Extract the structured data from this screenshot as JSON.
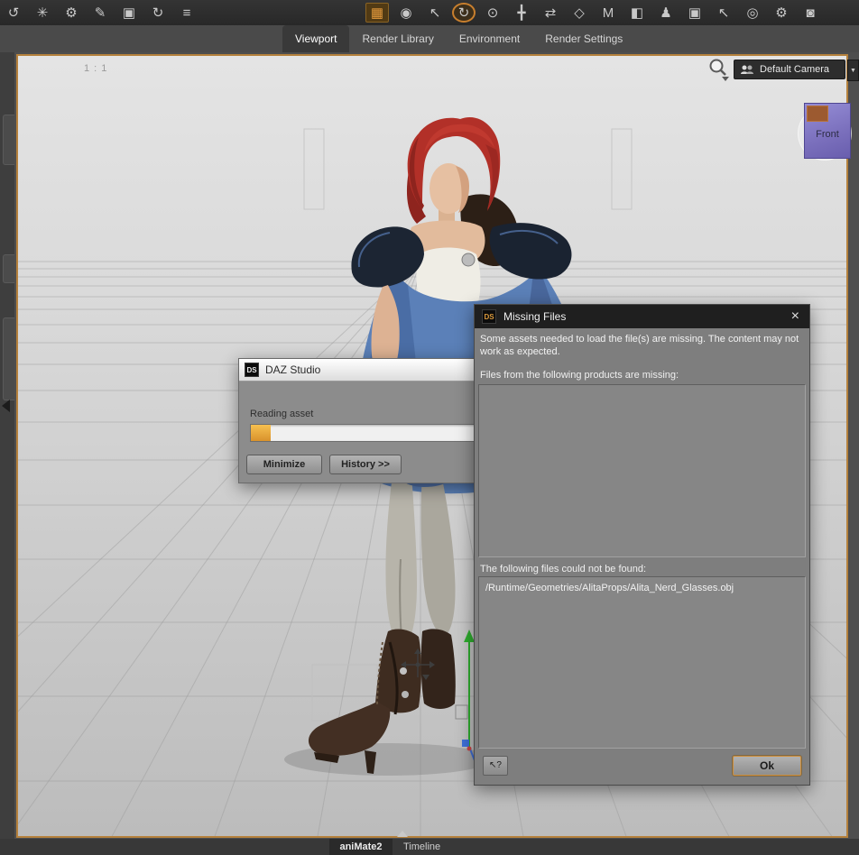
{
  "colors": {
    "accent_orange": "#c08238",
    "viewport_border": "#b5813c"
  },
  "toolbar": {
    "left_icons": [
      {
        "name": "orbit-left-icon",
        "glyph": "↺"
      },
      {
        "name": "snowflake-icon",
        "glyph": "✳"
      },
      {
        "name": "gear-sphere-icon",
        "glyph": "⚙"
      },
      {
        "name": "pen-tool-icon",
        "glyph": "✎"
      },
      {
        "name": "frame-camera-icon",
        "glyph": "▣"
      },
      {
        "name": "orbit-right-icon",
        "glyph": "↻"
      },
      {
        "name": "menu-list-icon",
        "glyph": "≡"
      }
    ],
    "main_icons": [
      {
        "name": "texture-grid-icon",
        "glyph": "▦"
      },
      {
        "name": "sphere-shaded-icon",
        "glyph": "◉"
      },
      {
        "name": "node-select-icon",
        "glyph": "↖"
      },
      {
        "name": "rotate-orbit-icon",
        "glyph": "↻"
      },
      {
        "name": "lasso-icon",
        "glyph": "⊙"
      },
      {
        "name": "universal-move-icon",
        "glyph": "╋"
      },
      {
        "name": "translate-icon",
        "glyph": "⇄"
      },
      {
        "name": "scale-icon",
        "glyph": "◇"
      },
      {
        "name": "measure-icon",
        "glyph": "M"
      },
      {
        "name": "cube-axis-icon",
        "glyph": "◧"
      },
      {
        "name": "figure-icon",
        "glyph": "♟"
      },
      {
        "name": "render-box-icon",
        "glyph": "▣"
      },
      {
        "name": "pointer-icon",
        "glyph": "↖"
      },
      {
        "name": "sphere-outline-icon",
        "glyph": "◎"
      },
      {
        "name": "gear-cube-icon",
        "glyph": "⚙"
      },
      {
        "name": "camera-render-icon",
        "glyph": "◙"
      }
    ]
  },
  "tabs": [
    {
      "label": "Viewport"
    },
    {
      "label": "Render Library"
    },
    {
      "label": "Environment"
    },
    {
      "label": "Render Settings"
    }
  ],
  "viewport": {
    "ratio_label": "1 : 1",
    "camera_selector": {
      "label": "Default Camera",
      "dropdown_glyph": "▼"
    },
    "view_cube": {
      "front_label": "Front"
    }
  },
  "dialogs": {
    "daz_studio": {
      "logo": "DS",
      "title": "DAZ Studio",
      "status_label": "Reading asset",
      "progress_percent": 8,
      "minimize_label": "Minimize",
      "history_label": "History >>"
    },
    "missing_files": {
      "logo": "DS",
      "title": "Missing Files",
      "close_glyph": "×",
      "message": "Some assets needed to load the file(s) are missing. The content may not work as expected.",
      "products_label": "Files from the following products are missing:",
      "files_label": "The following files could not be found:",
      "files": [
        "/Runtime/Geometries/AlitaProps/Alita_Nerd_Glasses.obj"
      ],
      "help_label": "↖?",
      "ok_label": "Ok"
    }
  },
  "bottom_bar": {
    "animate_tab": "aniMate2",
    "timeline_label": "Timeline"
  }
}
